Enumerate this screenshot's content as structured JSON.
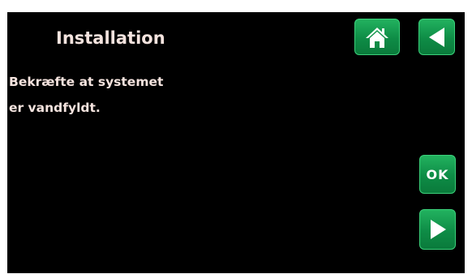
{
  "screen": {
    "title": "Installation",
    "message_lines": [
      "Bekræfte at systemet",
      "er vandfyldt."
    ]
  },
  "buttons": {
    "home": {
      "icon": "home-icon"
    },
    "back": {
      "icon": "arrow-left-icon"
    },
    "ok": {
      "label": "OK"
    },
    "next": {
      "icon": "arrow-right-icon"
    }
  },
  "colors": {
    "background": "#000000",
    "text": "#f4e3de",
    "button_green": "#0e8c46",
    "button_border": "#3bd07a"
  }
}
